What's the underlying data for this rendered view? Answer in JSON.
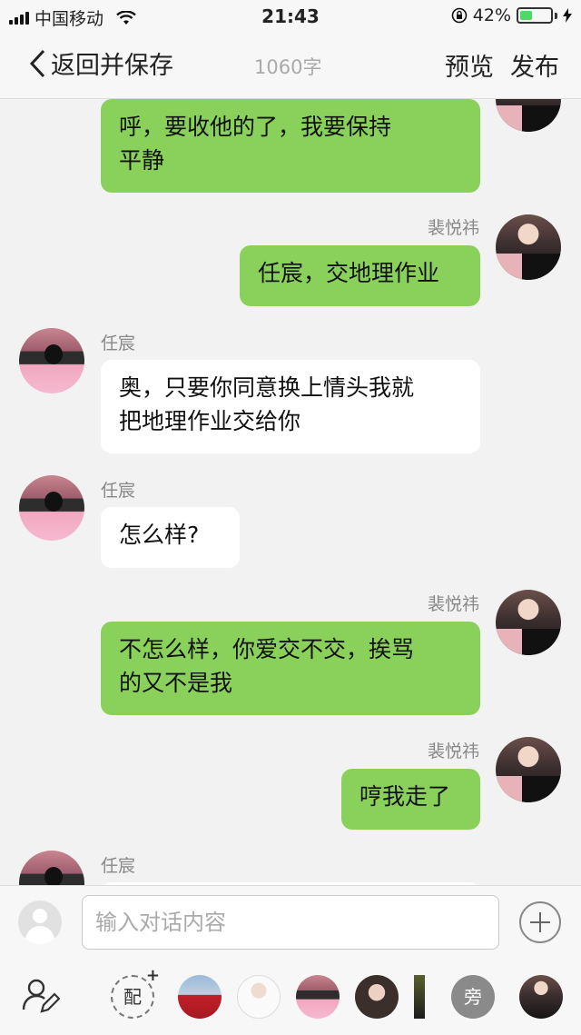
{
  "status_bar": {
    "carrier": "中国移动",
    "time": "21:43",
    "battery_percent": "42%",
    "battery_level": 0.42
  },
  "nav": {
    "back_label": "返回并保存",
    "word_count": "1060字",
    "preview_label": "预览",
    "publish_label": "发布"
  },
  "messages": [
    {
      "speaker": "",
      "text_lines": [
        "呼，要收他的了，我要保持",
        "平静"
      ],
      "side": "right"
    },
    {
      "speaker": "裴悦祎",
      "text_lines": [
        "任宸，交地理作业"
      ],
      "side": "right"
    },
    {
      "speaker": "任宸",
      "text_lines": [
        "奥，只要你同意换上情头我就",
        "把地理作业交给你"
      ],
      "side": "left"
    },
    {
      "speaker": "任宸",
      "text_lines": [
        "怎么样?"
      ],
      "side": "left"
    },
    {
      "speaker": "裴悦祎",
      "text_lines": [
        "不怎么样，你爱交不交，挨骂",
        "的又不是我"
      ],
      "side": "right"
    },
    {
      "speaker": "裴悦祎",
      "text_lines": [
        "哼我走了"
      ],
      "side": "right"
    },
    {
      "speaker": "任宸",
      "text_lines": [],
      "side": "left"
    }
  ],
  "input": {
    "placeholder": "输入对话内容"
  },
  "toolbar": {
    "pei_label": "配",
    "pang_label": "旁"
  },
  "colors": {
    "green_bubble": "#8ad15b",
    "white_bubble": "#ffffff",
    "background": "#f2f2f2"
  }
}
